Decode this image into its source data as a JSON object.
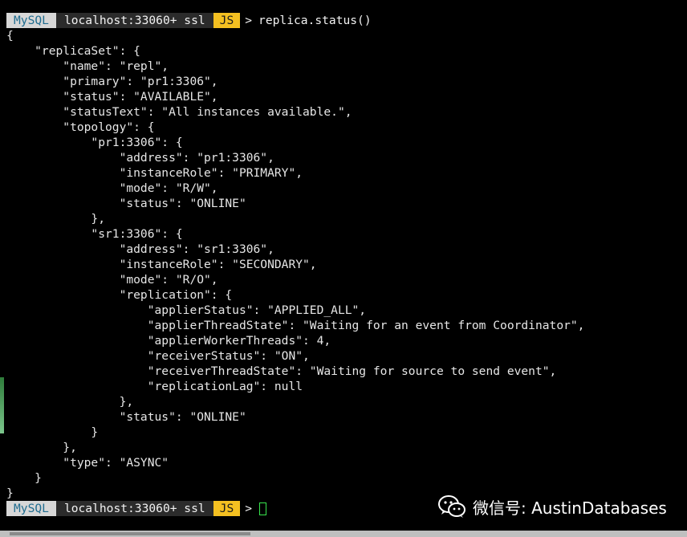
{
  "prompt": {
    "mysql": "MySQL",
    "host": "localhost:33060+ ssl",
    "mode": "JS",
    "arrow": ">"
  },
  "command": "replica.status()",
  "output_lines": [
    "{",
    "    \"replicaSet\": {",
    "        \"name\": \"repl\",",
    "        \"primary\": \"pr1:3306\",",
    "        \"status\": \"AVAILABLE\",",
    "        \"statusText\": \"All instances available.\",",
    "        \"topology\": {",
    "            \"pr1:3306\": {",
    "                \"address\": \"pr1:3306\",",
    "                \"instanceRole\": \"PRIMARY\",",
    "                \"mode\": \"R/W\",",
    "                \"status\": \"ONLINE\"",
    "            },",
    "            \"sr1:3306\": {",
    "                \"address\": \"sr1:3306\",",
    "                \"instanceRole\": \"SECONDARY\",",
    "                \"mode\": \"R/O\",",
    "                \"replication\": {",
    "                    \"applierStatus\": \"APPLIED_ALL\",",
    "                    \"applierThreadState\": \"Waiting for an event from Coordinator\",",
    "                    \"applierWorkerThreads\": 4,",
    "                    \"receiverStatus\": \"ON\",",
    "                    \"receiverThreadState\": \"Waiting for source to send event\",",
    "                    \"replicationLag\": null",
    "                },",
    "                \"status\": \"ONLINE\"",
    "            }",
    "        },",
    "        \"type\": \"ASYNC\"",
    "    }",
    "}"
  ],
  "watermark": "微信号: AustinDatabases",
  "colors": {
    "background": "#000000",
    "text": "#e6e6e6",
    "prompt_mysql_bg": "#d7d7d7",
    "prompt_mysql_fg": "#1f6c8f",
    "prompt_host_bg": "#2b2b2b",
    "prompt_js_bg": "#f4c021",
    "cursor": "#38e54d"
  }
}
